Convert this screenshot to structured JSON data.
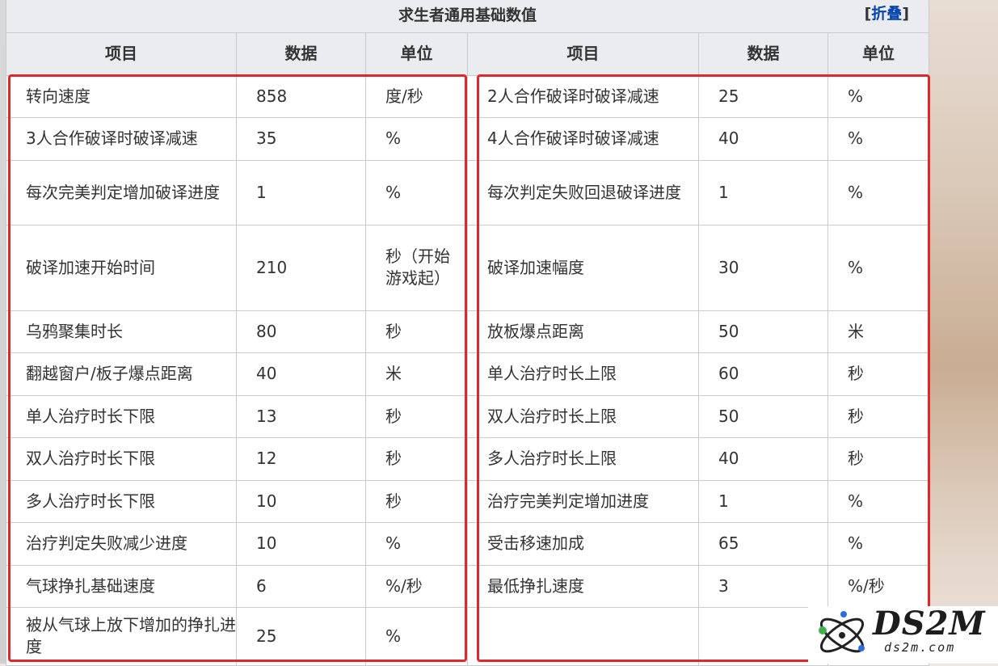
{
  "table": {
    "caption": "求生者通用基础数值",
    "toggle_open": "[",
    "toggle_label": "折叠",
    "toggle_close": "]",
    "headers": [
      "项目",
      "数据",
      "单位",
      "项目",
      "数据",
      "单位"
    ],
    "rows": [
      [
        "转向速度",
        "858",
        "度/秒",
        "2人合作破译时破译减速",
        "25",
        "%"
      ],
      [
        "3人合作破译时破译减速",
        "35",
        "%",
        "4人合作破译时破译减速",
        "40",
        "%"
      ],
      [
        "每次完美判定增加破译进度",
        "1",
        "%",
        "每次判定失败回退破译进度",
        "1",
        "%"
      ],
      [
        "破译加速开始时间",
        "210",
        "秒（开始游戏起）",
        "破译加速幅度",
        "30",
        "%"
      ],
      [
        "乌鸦聚集时长",
        "80",
        "秒",
        "放板爆点距离",
        "50",
        "米"
      ],
      [
        "翻越窗户/板子爆点距离",
        "40",
        "米",
        "单人治疗时长上限",
        "60",
        "秒"
      ],
      [
        "单人治疗时长下限",
        "13",
        "秒",
        "双人治疗时长上限",
        "50",
        "秒"
      ],
      [
        "双人治疗时长下限",
        "12",
        "秒",
        "多人治疗时长上限",
        "40",
        "秒"
      ],
      [
        "多人治疗时长下限",
        "10",
        "秒",
        "治疗完美判定增加进度",
        "1",
        "%"
      ],
      [
        "治疗判定失败减少进度",
        "10",
        "%",
        "受击移速加成",
        "65",
        "%"
      ],
      [
        "气球挣扎基础速度",
        "6",
        "%/秒",
        "最低挣扎速度",
        "3",
        "%/秒"
      ],
      [
        "被从气球上放下增加的挣扎进度",
        "25",
        "%",
        "",
        "",
        ""
      ]
    ]
  },
  "watermark": {
    "brand": "DS2M",
    "domain": "ds2m.com"
  },
  "colors": {
    "highlight": "#e0282a",
    "header_bg": "#eaecf0",
    "link": "#0645ad",
    "border": "#c8ccd1"
  }
}
